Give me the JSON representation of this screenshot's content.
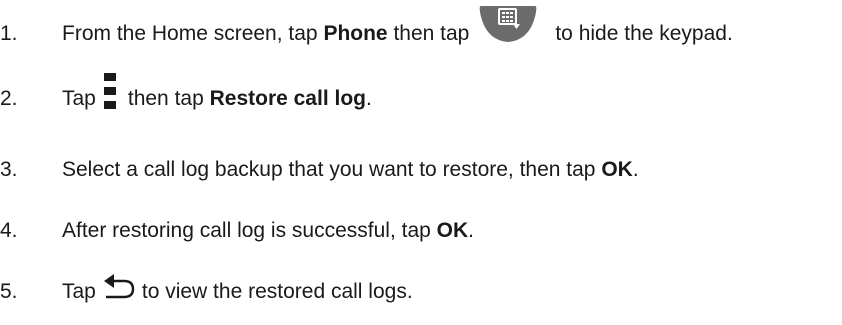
{
  "steps": [
    {
      "number": "1.",
      "text_before": "From the Home screen, tap ",
      "bold_1": "Phone",
      "text_middle": " then tap",
      "icon": "hide-keypad-icon",
      "text_after": "to hide the keypad."
    },
    {
      "number": "2.",
      "text_before": "Tap",
      "icon": "more-options-icon",
      "text_middle": "then tap ",
      "bold_1": "Restore call log",
      "text_after": "."
    },
    {
      "number": "3.",
      "text_before": "Select a call log backup that you want to restore, then tap ",
      "bold_1": "OK",
      "text_after": "."
    },
    {
      "number": "4.",
      "text_before": "After restoring call log is successful, tap ",
      "bold_1": "OK",
      "text_after": "."
    },
    {
      "number": "5.",
      "text_before": "Tap",
      "icon": "back-icon",
      "text_after": "to view the restored call logs."
    }
  ],
  "colors": {
    "text": "#1a1a1a",
    "icon_fill": "#6b6b6b",
    "icon_glyph": "#ffffff"
  }
}
